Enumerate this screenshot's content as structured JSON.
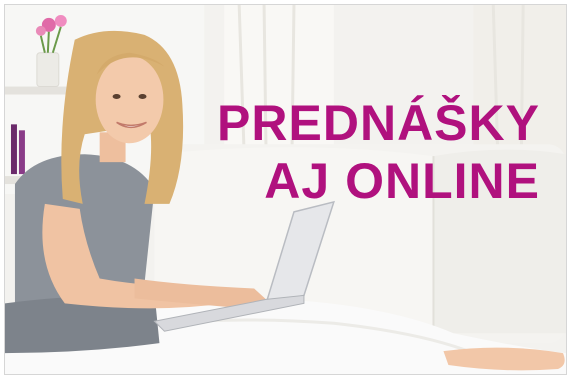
{
  "banner": {
    "headline_line1": "PREDNÁŠKY",
    "headline_line2": "AJ ONLINE",
    "headline_color": "#b0117e",
    "photo": "woman-with-laptop-on-sofa"
  }
}
